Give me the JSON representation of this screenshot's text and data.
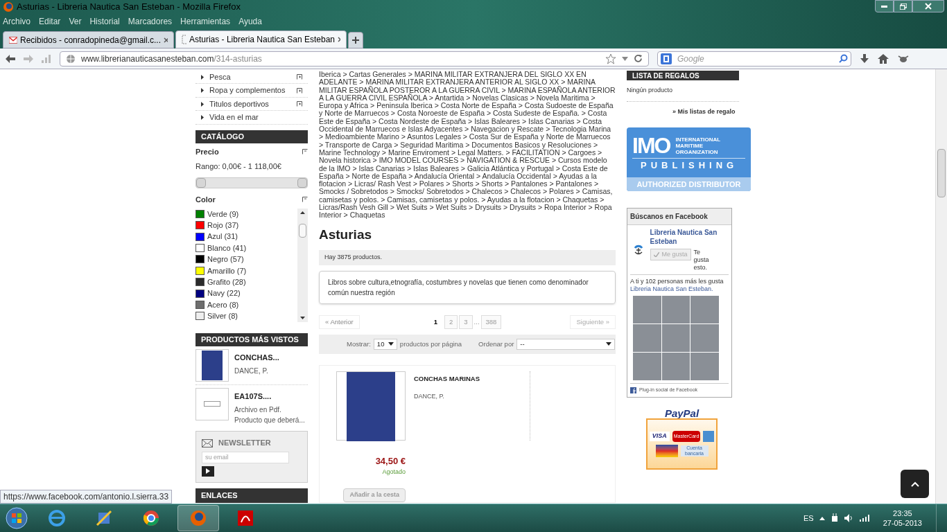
{
  "window": {
    "title": "Asturias - Libreria Nautica San Esteban - Mozilla Firefox"
  },
  "menu": [
    "Archivo",
    "Editar",
    "Ver",
    "Historial",
    "Marcadores",
    "Herramientas",
    "Ayuda"
  ],
  "tabs": [
    {
      "label": "Recibidos - conradopineda@gmail.c...",
      "kind": "mail",
      "selected": false
    },
    {
      "label": "Asturias - Libreria Nautica San Esteban",
      "kind": "page",
      "selected": true
    }
  ],
  "address_bar": {
    "host": "www.librerianauticasanesteban.com",
    "path": "/314-asturias"
  },
  "search": {
    "placeholder": "Google"
  },
  "categories": [
    {
      "label": "Pesca",
      "expandable": true
    },
    {
      "label": "Ropa y complementos",
      "expandable": true
    },
    {
      "label": "Titulos deportivos",
      "expandable": true
    },
    {
      "label": "Vida en el mar",
      "expandable": false
    }
  ],
  "catalog": {
    "title": "CATÁLOGO",
    "price_label": "Precio",
    "price_range": "Rango: 0,00€ - 1 118,00€",
    "price_slider": {
      "handles": [
        {
          "level": 0
        },
        {
          "level": 1
        }
      ]
    },
    "color_label": "Color",
    "colors": [
      {
        "label": "Verde (9)",
        "color": "#008000"
      },
      {
        "label": "Rojo (37)",
        "color": "#ff0000"
      },
      {
        "label": "Azul (31)",
        "color": "#0000ff"
      },
      {
        "label": "Blanco (41)",
        "color": "#ffffff"
      },
      {
        "label": "Negro (57)",
        "color": "#000000"
      },
      {
        "label": "Amarillo (7)",
        "color": "#ffff00"
      },
      {
        "label": "Grafito (28)",
        "color": "#2b2b2b"
      },
      {
        "label": "Navy (22)",
        "color": "#000080"
      },
      {
        "label": "Acero (8)",
        "color": "#6e6e6e"
      },
      {
        "label": "Silver (8)",
        "color": "#eeeeee"
      }
    ]
  },
  "most_viewed": {
    "title": "PRODUCTOS MÁS VISTOS",
    "items": [
      {
        "title": "CONCHAS...",
        "text": "DANCE, P.",
        "kind": "book"
      },
      {
        "title": "EA107S....",
        "text": "Archivo en Pdf. Producto que deberá...",
        "kind": "document"
      }
    ]
  },
  "newsletter": {
    "title": "NEWSLETTER",
    "placeholder": "su email"
  },
  "links_title": "ENLACES",
  "breadcrumb": "Iberica > Cartas Generales > MARINA MILITAR EXTRANJERA DEL SIGLO XX EN ADELANTE > MARINA MILITAR EXTRANJERA ANTERIOR AL SIGLO XX > MARINA MILITAR ESPAÑOLA POSTEROR A LA GUERRA CIVIL > MARINA ESPAÑOLA ANTERIOR A LA GUERRA CIVIL ESPAÑOLA > Antartida > Novelas Clasicas > Novela Maritima > Europa y Africa > Peninsula Iberica > Costa Norte de España > Costa Sudoeste de España y Norte de Marruecos > Costa Noroeste de España > Costa Sudeste de España. > Costa Este de España > Costa Nordeste de España > Islas Baleares > Islas Canarias > Costa Occidental de Marruecos e Islas Adyacentes > Navegacion y Rescate > Tecnologia Marina > Medioambiente Marino > Asuntos Legales > Costa Sur de España y Norte de Marruecos > Transporte de Carga > Seguridad Maritima > Documentos Basicos y Resoluciones > Marine Technology > Marine Enviroment > Legal Matters. > FACILITATION > Cargoes > Novela historica > IMO MODEL COURSES > NAVIGATION & RESCUE > Cursos modelo de la IMO > Islas Canarias > Islas Baleares > Galicia Atlántica y Portugal > Costa Este de España > Norte de España > Andalucía Oriental > Andalucía Occidental > Ayudas a la flotacion > Licras/ Rash Vest > Polares > Shorts > Shorts > Pantalones > Pantalones > Smocks / Sobretodos > Smocks/ Sobretodos > Chalecos > Chalecos > Polares > Camisas, camisetas y polos. > Camisas, camisetas y polos. > Ayudas a la flotacion > Chaquetas > Licras/Rash Vesh Gill > Wet Suits > Wet Suits > Drysuits > Drysuits > Ropa Interior > Ropa Interior > Chaquetas",
  "heading": "Asturias",
  "count": "Hay 3875 productos.",
  "description": "Libros sobre cultura,etnografía, costumbres y novelas que tienen como denominador común nuestra región",
  "pagination": {
    "previous": "« Anterior",
    "next": "Siguiente »",
    "pages": [
      {
        "label": "1",
        "kind": "page",
        "selected": true
      },
      {
        "label": "2",
        "kind": "page",
        "selected": false
      },
      {
        "label": "3",
        "kind": "page",
        "selected": false
      },
      {
        "label": "...",
        "kind": "gap"
      },
      {
        "label": "388",
        "kind": "page",
        "selected": false
      }
    ]
  },
  "sort_bar": {
    "show_label": "Mostrar:",
    "show_value": "10",
    "per_page": "productos por página",
    "order_label": "Ordenar por",
    "order_value": "--"
  },
  "product": {
    "name": "CONCHAS MARINAS",
    "author": "DANCE, P.",
    "price": "34,50 €",
    "availability": "Agotado",
    "button": "Añadir a la cesta"
  },
  "gift_list": {
    "title": "LISTA DE REGALOS",
    "empty": "Ningún producto",
    "link": "» Mis listas de regalo"
  },
  "imo_banner": {
    "logo": "IMO",
    "organization": "INTERNATIONAL MARITIME ORGANIZATION",
    "publishing": "PUBLISHING",
    "distributor": "AUTHORIZED DISTRIBUTOR"
  },
  "facebook": {
    "title": "Búscanos en Facebook",
    "page_name": "Libreria Nautica San Esteban",
    "like": "Me gusta",
    "liked_note": "Te gusta esto.",
    "friends_text": "A ti y 102 personas más les gusta",
    "friends_link": "Libreria Nautica San Esteban.",
    "footer": "Plug-in social de Facebook"
  },
  "paypal": {
    "brand": "PayPal",
    "visa": "VISA",
    "mastercard": "MasterCard",
    "bank": "Cuenta bancaria"
  },
  "status_url": "https://www.facebook.com/antonio.l.sierra.33",
  "taskbar": {
    "language": "ES",
    "time": "23:35",
    "date": "27-05-2013"
  }
}
